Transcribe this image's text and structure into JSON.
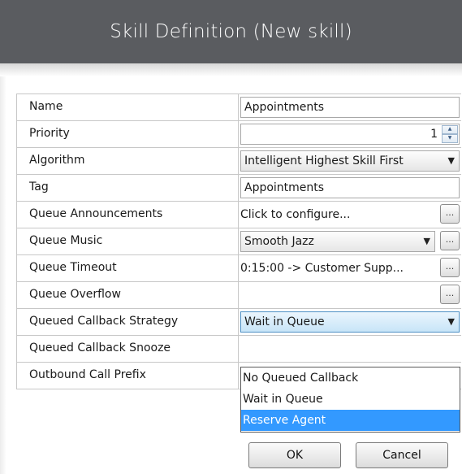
{
  "window": {
    "title": "Skill Definition (New skill)"
  },
  "fields": {
    "name": {
      "label": "Name",
      "value": "Appointments"
    },
    "priority": {
      "label": "Priority",
      "value": "1"
    },
    "algorithm": {
      "label": "Algorithm",
      "value": "Intelligent Highest Skill First"
    },
    "tag": {
      "label": "Tag",
      "value": "Appointments"
    },
    "queue_announcements": {
      "label": "Queue Announcements",
      "value": "Click to configure...",
      "button": "..."
    },
    "queue_music": {
      "label": "Queue Music",
      "value": "Smooth Jazz",
      "button": "..."
    },
    "queue_timeout": {
      "label": "Queue Timeout",
      "value": "0:15:00 -> Customer Supp...",
      "button": "..."
    },
    "queue_overflow": {
      "label": "Queue Overflow",
      "value": "",
      "button": "..."
    },
    "callback_strategy": {
      "label": "Queued Callback Strategy",
      "value": "Wait in Queue"
    },
    "callback_snooze": {
      "label": "Queued Callback Snooze",
      "value": ""
    },
    "outbound_prefix": {
      "label": "Outbound Call Prefix",
      "value": ""
    }
  },
  "dropdown": {
    "options": [
      "No Queued Callback",
      "Wait in Queue",
      "Reserve Agent"
    ],
    "highlighted": "Reserve Agent"
  },
  "buttons": {
    "ok": "OK",
    "cancel": "Cancel"
  },
  "icons": {
    "combo_arrow": "triangle-down-icon",
    "spin_up": "triangle-up-icon",
    "spin_down": "triangle-down-icon"
  },
  "colors": {
    "titlebar": "#5a5c60",
    "selection": "#3399ff",
    "active_combo_border": "#4e90c4"
  }
}
